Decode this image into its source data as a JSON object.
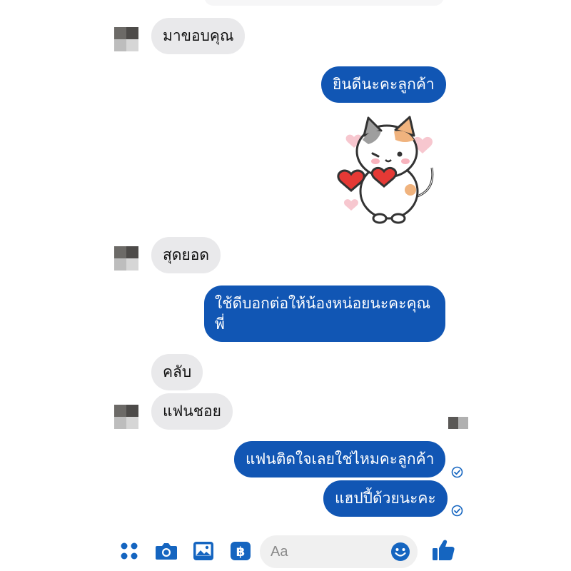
{
  "colors": {
    "outgoing": "#1156b4",
    "incoming": "#e9e9eb",
    "accent": "#1565c0"
  },
  "messages": [
    {
      "side": "in",
      "text": "มาขอบคุณ"
    },
    {
      "side": "out",
      "text": "ยินดีนะคะลูกค้า"
    },
    {
      "side": "out",
      "type": "sticker",
      "icon": "cat-with-hearts-sticker"
    },
    {
      "side": "in",
      "text": "สุดยอด"
    },
    {
      "side": "out",
      "text": "ใช้ดีบอกต่อให้น้องหน่อยนะคะคุณ",
      "text2": "พี่"
    },
    {
      "side": "in",
      "text": "คลับ"
    },
    {
      "side": "in",
      "text": "แฟนชอย"
    },
    {
      "side": "out",
      "text": "แฟนติดใจเลยใช่ไหมคะลูกค้า",
      "status": "sent-check-icon"
    },
    {
      "side": "out",
      "text": "แฮปปี้ด้วยนะคะ",
      "status": "sent-check-icon"
    }
  ],
  "composer": {
    "placeholder": "Aa",
    "icons": [
      "menu-dots-icon",
      "camera-icon",
      "image-icon",
      "payment-icon",
      "emoji-icon",
      "like-thumb-icon"
    ]
  }
}
